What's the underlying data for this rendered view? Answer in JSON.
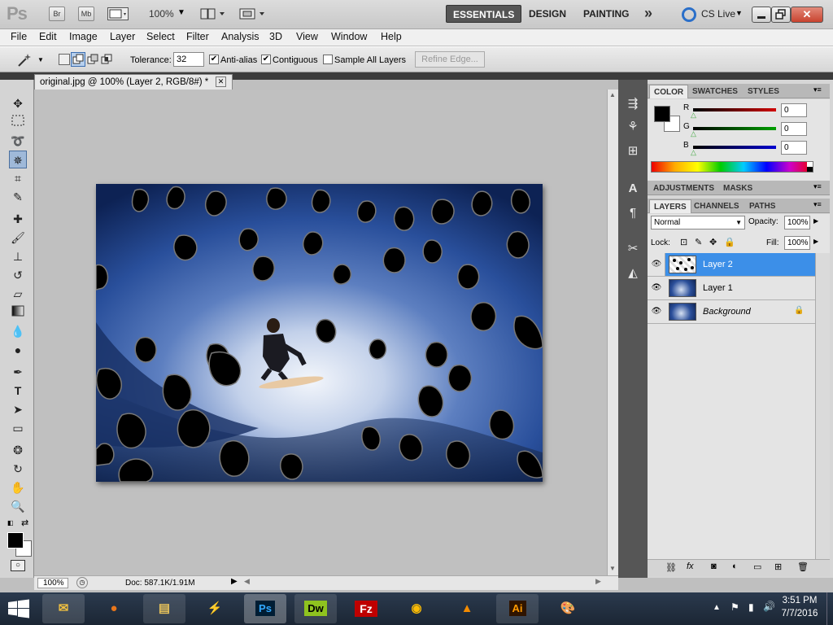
{
  "app": {
    "logo": "Ps",
    "bridge_label": "Br",
    "minibridge_label": "Mb",
    "zoom": "100%",
    "workspaces": [
      "ESSENTIALS",
      "DESIGN",
      "PAINTING"
    ],
    "more_label": "»",
    "cslive": "CS Live"
  },
  "menu": [
    "File",
    "Edit",
    "Image",
    "Layer",
    "Select",
    "Filter",
    "Analysis",
    "3D",
    "View",
    "Window",
    "Help"
  ],
  "options": {
    "tolerance_label": "Tolerance:",
    "tolerance_value": "32",
    "antialias_label": "Anti-alias",
    "antialias_checked": true,
    "contiguous_label": "Contiguous",
    "contiguous_checked": true,
    "sample_all_label": "Sample All Layers",
    "sample_all_checked": false,
    "refine_edge_label": "Refine Edge..."
  },
  "document": {
    "tab_title": "original.jpg @ 100% (Layer 2, RGB/8#) *",
    "zoom": "100%",
    "doc_size": "Doc: 587.1K/1.91M"
  },
  "color_panel": {
    "tabs": [
      "COLOR",
      "SWATCHES",
      "STYLES"
    ],
    "channels": [
      {
        "label": "R",
        "value": "0",
        "color": "#d00000"
      },
      {
        "label": "G",
        "value": "0",
        "color": "#00a000"
      },
      {
        "label": "B",
        "value": "0",
        "color": "#0000d0"
      }
    ]
  },
  "adjustments_panel": {
    "tabs": [
      "ADJUSTMENTS",
      "MASKS"
    ]
  },
  "layers_panel": {
    "tabs": [
      "LAYERS",
      "CHANNELS",
      "PATHS"
    ],
    "blend_mode": "Normal",
    "opacity_label": "Opacity:",
    "opacity_value": "100%",
    "lock_label": "Lock:",
    "fill_label": "Fill:",
    "fill_value": "100%",
    "layers": [
      {
        "name": "Layer 2",
        "selected": true
      },
      {
        "name": "Layer 1",
        "selected": false
      },
      {
        "name": "Background",
        "selected": false,
        "locked": true
      }
    ]
  },
  "taskbar": {
    "time": "3:51 PM",
    "date": "7/7/2016",
    "apps": [
      "outlook",
      "firefox",
      "explorer",
      "flash",
      "Ps",
      "Dw",
      "filezilla",
      "chrome",
      "vlc",
      "Ai",
      "paint"
    ]
  },
  "colors": {
    "selected_layer": "#3c8fe8",
    "active_workspace": "#555555",
    "close_button": "#c9432f"
  }
}
